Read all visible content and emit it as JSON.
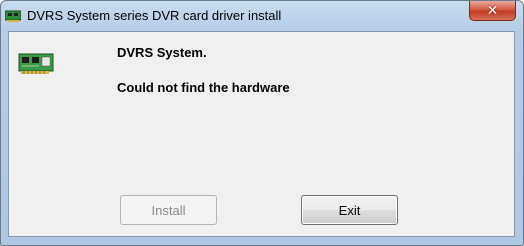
{
  "window": {
    "title": "DVRS System series DVR card driver install",
    "close_label": "✕"
  },
  "icons": {
    "app": "hardware-card-icon",
    "content": "hardware-card-icon"
  },
  "content": {
    "heading": "DVRS System.",
    "message": "Could not find the hardware"
  },
  "buttons": {
    "install": {
      "label": "Install",
      "enabled": false
    },
    "exit": {
      "label": "Exit",
      "enabled": true
    }
  }
}
